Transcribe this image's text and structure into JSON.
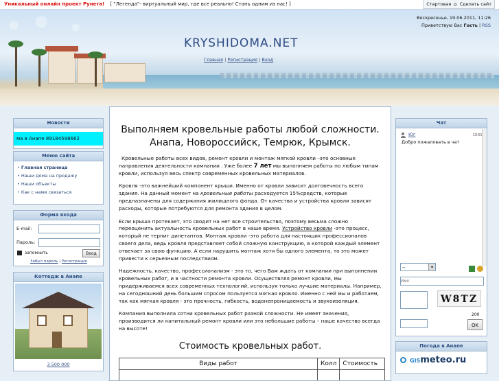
{
  "topbar": {
    "promo": "Уникальный онлайн проект Рунета!",
    "banner": "[ \"Легенда\"- виртуальный мир, где все реально! Стань одним из нас! ]",
    "start_link": "Стартовая",
    "make_home": "Сделать сайт"
  },
  "header": {
    "site_title": "KRYSHIDOMA.NET",
    "nav": [
      "Главная",
      "Регистрация",
      "Вход"
    ],
    "datetime": "Воскресенье, 19.06.2011, 11:26",
    "greeting_prefix": "Приветствую Вас",
    "guest": "Гость",
    "rss": "RSS"
  },
  "news": {
    "title": "Новости",
    "ticker": "ма в Анапе 89184598662"
  },
  "menu": {
    "title": "Меню сайта",
    "items": [
      "Главная страница",
      "Наши дома на продажу",
      "Наши объекты",
      "Как с нами связаться"
    ]
  },
  "login": {
    "title": "Форма входа",
    "email_label": "E-mail:",
    "password_label": "Пароль:",
    "remember": "запомнить",
    "submit": "Вход",
    "forgot": "Забыл пароль",
    "register": "Регистрация"
  },
  "cottage": {
    "title": "Коттедж в Анапе",
    "price": "3 500 000"
  },
  "main": {
    "heading_line1": "Выполняем кровельные работы любой сложности.",
    "heading_line2": "Анапа, Новороссийск, Темрюк, Крымск.",
    "p1a": "Кровельные работы всех видов, ремонт кровли и монтаж мягкой кровли –это основные направления деятельности компании . Уже более ",
    "p1b": "7 лет",
    "p1c": " мы выполняем работы по любым типам кровли, используя весь спектр современных кровельных материалов.",
    "p2a": "Кровля -это важнейший компонент крыши. Именно от кровли зависит долговечность всего здания. На данный момент на ",
    "p2b": "кровельные работы",
    "p2c": " расходуется 15%средств, которые предназначены для содержания жилищного фонда. От качества и устройства кровли зависят расходы, которые потребуются для ремонта здания в целом.",
    "p3a": "Если крыша протекает, это сводит на нет все строительство, поэтому весьма сложно переоценить актуальность кровельных работ в наше время. ",
    "p3b": "Устройство кровли",
    "p3c": " -это процесс, который не терпит дилетантов. Монтаж кровли -это работа для настоящих профессионалов своего дела, ведь кровля представляет собой сложную конструкцию, в которой каждый элемент отвечает за свою функцию. А если нарушить монтаж хотя бы одного элемента, то это может привести к серьезным последствиям.",
    "p4": "Надежность, качество, профессионализм - это то, чего Вам ждать от компании при выполнении кровельных работ, и в частности ремонта кровли. Осуществляя ремонт кровли, мы придерживаемся всех современных технологий, используя только лучшие материалы. Например, на сегодняшний день большим спросом пользуется мягкая кровля. Именно с ней мы и работаем, так как мягкая кровля - это прочность, гибкость, водонепроницаемость и звукоизоляция.",
    "p5": "Компания выполнила сотни кровельных работ разной сложности. Не имеет значения, производится ли капитальный ремонт кровли или это небольшие работы – наше качество всегда на высоте!",
    "price_heading": "Стоимость кровельных работ.",
    "table_headers": [
      "Виды работ",
      "Колл",
      "Стоимость"
    ]
  },
  "chat": {
    "title": "Чат",
    "user": "Юг",
    "time": "19:59",
    "message": "Добро пожаловать в чат",
    "name_placeholder": "Имя",
    "select_value": "--",
    "captcha": "W8TZ",
    "counter": "200",
    "ok": "OK"
  },
  "weather": {
    "title": "Погода в Анапе",
    "brand_prefix": "GIS",
    "brand": "meteo.ru"
  },
  "colors": {
    "accent": "#2d4b84",
    "panel_header": "#c8dbee",
    "ticker_bg": "#00f0ff"
  }
}
